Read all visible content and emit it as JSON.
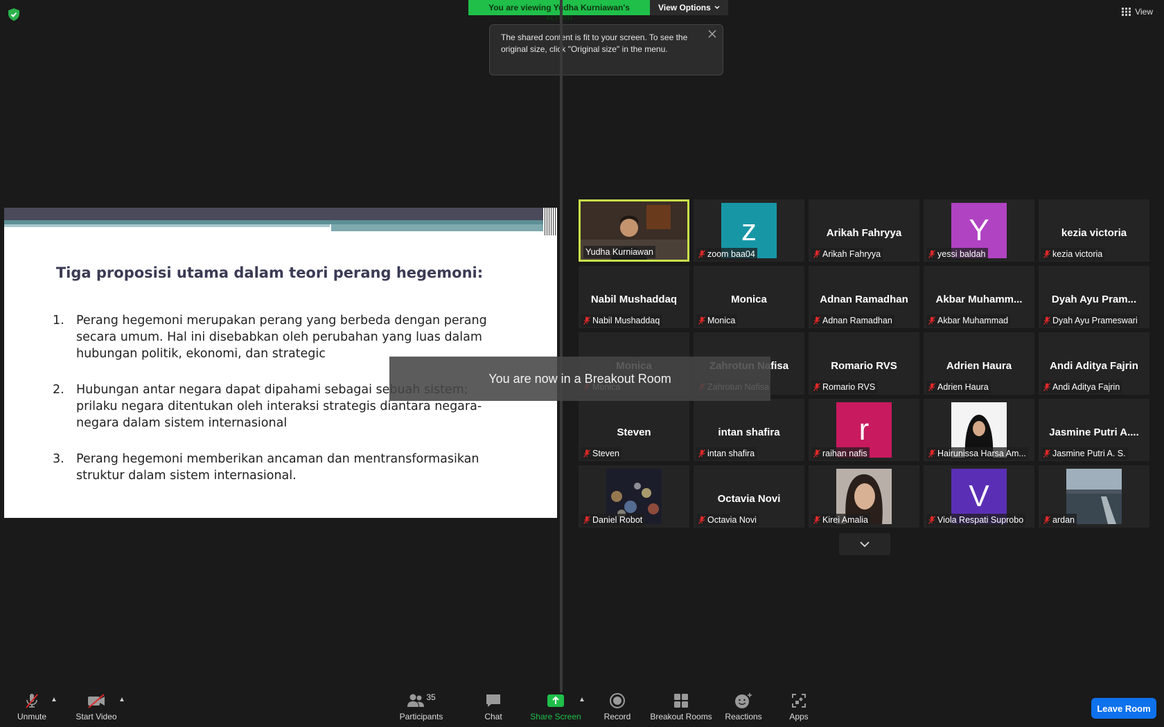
{
  "top": {
    "banner_text": "You are viewing Yudha Kurniawan's screen",
    "view_options_label": "View Options",
    "view_label": "View",
    "tooltip_text": "The shared content is fit to your screen. To see the original size, click \"Original size\" in the menu."
  },
  "slide": {
    "title": "Tiga proposisi utama dalam teori perang hegemoni:",
    "items": [
      {
        "num": "1.",
        "text": "Perang hegemoni merupakan perang yang berbeda dengan perang secara umum. Hal ini disebabkan oleh perubahan yang luas dalam hubungan politik, ekonomi, dan strategic"
      },
      {
        "num": "2.",
        "text": "Hubungan antar negara dapat dipahami sebagai sebuah sistem; prilaku negara ditentukan oleh interaksi strategis diantara negara-negara dalam sistem internasional"
      },
      {
        "num": "3.",
        "text": "Perang hegemoni memberikan ancaman dan mentransformasikan struktur dalam sistem internasional."
      }
    ]
  },
  "breakout_message": "You are now in a Breakout Room",
  "participants": [
    {
      "name": "Yudha Kurniawan",
      "big": "",
      "kind": "video"
    },
    {
      "name": "zoom baa04",
      "big": "z",
      "kind": "avatar",
      "color": "#1797a6"
    },
    {
      "name": "Arikah Fahryya",
      "big": "Arikah Fahryya",
      "kind": "text"
    },
    {
      "name": "yessi baldah",
      "big": "Y",
      "kind": "avatar",
      "color": "#b043c2"
    },
    {
      "name": "kezia victoria",
      "big": "kezia victoria",
      "kind": "text"
    },
    {
      "name": "Nabil Mushaddaq",
      "big": "Nabil Mushaddaq",
      "kind": "text"
    },
    {
      "name": "Monica",
      "big": "Monica",
      "kind": "text"
    },
    {
      "name": "Adnan Ramadhan",
      "big": "Adnan Ramadhan",
      "kind": "text"
    },
    {
      "name": "Akbar Muhammad",
      "big": "Akbar  Muhamm...",
      "kind": "text"
    },
    {
      "name": "Dyah Ayu Prameswari",
      "big": "Dyah Ayu Pram...",
      "kind": "text"
    },
    {
      "name": "Monica",
      "big": "Monica",
      "kind": "text"
    },
    {
      "name": "Zahrotun Nafisa",
      "big": "Zahrotun Nafisa",
      "kind": "text"
    },
    {
      "name": "Romario RVS",
      "big": "Romario RVS",
      "kind": "text"
    },
    {
      "name": "Adrien Haura",
      "big": "Adrien Haura",
      "kind": "text"
    },
    {
      "name": "Andi Aditya Fajrin",
      "big": "Andi Aditya Fajrin",
      "kind": "text"
    },
    {
      "name": "Steven",
      "big": "Steven",
      "kind": "text"
    },
    {
      "name": "intan shafira",
      "big": "intan shafira",
      "kind": "text"
    },
    {
      "name": "raihan nafis",
      "big": "r",
      "kind": "avatar",
      "color": "#c81a5e"
    },
    {
      "name": "Hairunissa Harsa Am...",
      "big": "",
      "kind": "photo-hijab"
    },
    {
      "name": "Jasmine Putri A. S.",
      "big": "Jasmine Putri A....",
      "kind": "text"
    },
    {
      "name": "Daniel Robot",
      "big": "",
      "kind": "photo-bokeh"
    },
    {
      "name": "Octavia Novi",
      "big": "Octavia Novi",
      "kind": "text"
    },
    {
      "name": "Kirei Amalia",
      "big": "",
      "kind": "photo-face"
    },
    {
      "name": "Viola Respati Suprobo",
      "big": "V",
      "kind": "avatar",
      "color": "#5b2fb5"
    },
    {
      "name": "ardan",
      "big": "",
      "kind": "photo-sea"
    }
  ],
  "toolbar": {
    "unmute": "Unmute",
    "start_video": "Start Video",
    "participants": "Participants",
    "participants_count": "35",
    "chat": "Chat",
    "share_screen": "Share Screen",
    "record": "Record",
    "breakout_rooms": "Breakout Rooms",
    "reactions": "Reactions",
    "apps": "Apps",
    "leave_room": "Leave Room"
  },
  "colors": {
    "banner_green": "#1fbf4a",
    "active_speaker_border": "#c8e04a",
    "leave_blue": "#0e72ed",
    "share_green": "#1fbf4a",
    "mute_red": "#e02828"
  }
}
